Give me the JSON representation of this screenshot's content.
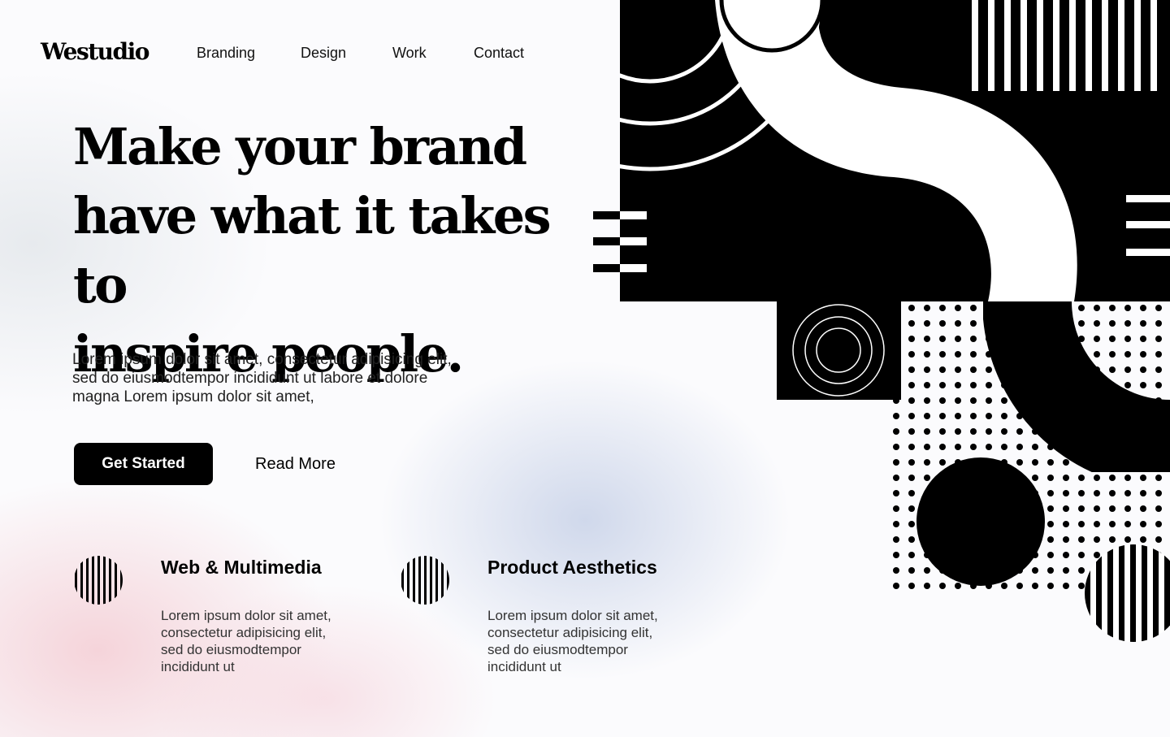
{
  "brand": {
    "logo_text": "Westudio"
  },
  "nav": {
    "items": [
      "Branding",
      "Design",
      "Work",
      "Contact"
    ]
  },
  "hero": {
    "title_lines": [
      "Make your brand",
      "have what it takes to",
      "inspire people."
    ],
    "description_lines": [
      "Lorem ipsum dolor sit amet, consectetur adipisicing elit,",
      "sed do eiusmodtempor incididunt ut labore et dolore",
      "magna Lorem ipsum dolor sit amet,"
    ],
    "primary_button": "Get Started",
    "secondary_button": "Read More"
  },
  "features": [
    {
      "title": "Web & Multimedia",
      "desc_lines": [
        "Lorem ipsum dolor sit amet,",
        "consectetur adipisicing elit,",
        "sed do eiusmodtempor",
        "incididunt ut"
      ],
      "icon": "striped-circle-icon"
    },
    {
      "title": "Product Aesthetics",
      "desc_lines": [
        "Lorem ipsum dolor sit amet,",
        "consectetur adipisicing elit,",
        "sed do eiusmodtempor",
        "incididunt ut"
      ],
      "icon": "striped-circle-icon"
    }
  ],
  "colors": {
    "primary": "#000000",
    "background": "#fbfbfd",
    "text": "#222222"
  }
}
